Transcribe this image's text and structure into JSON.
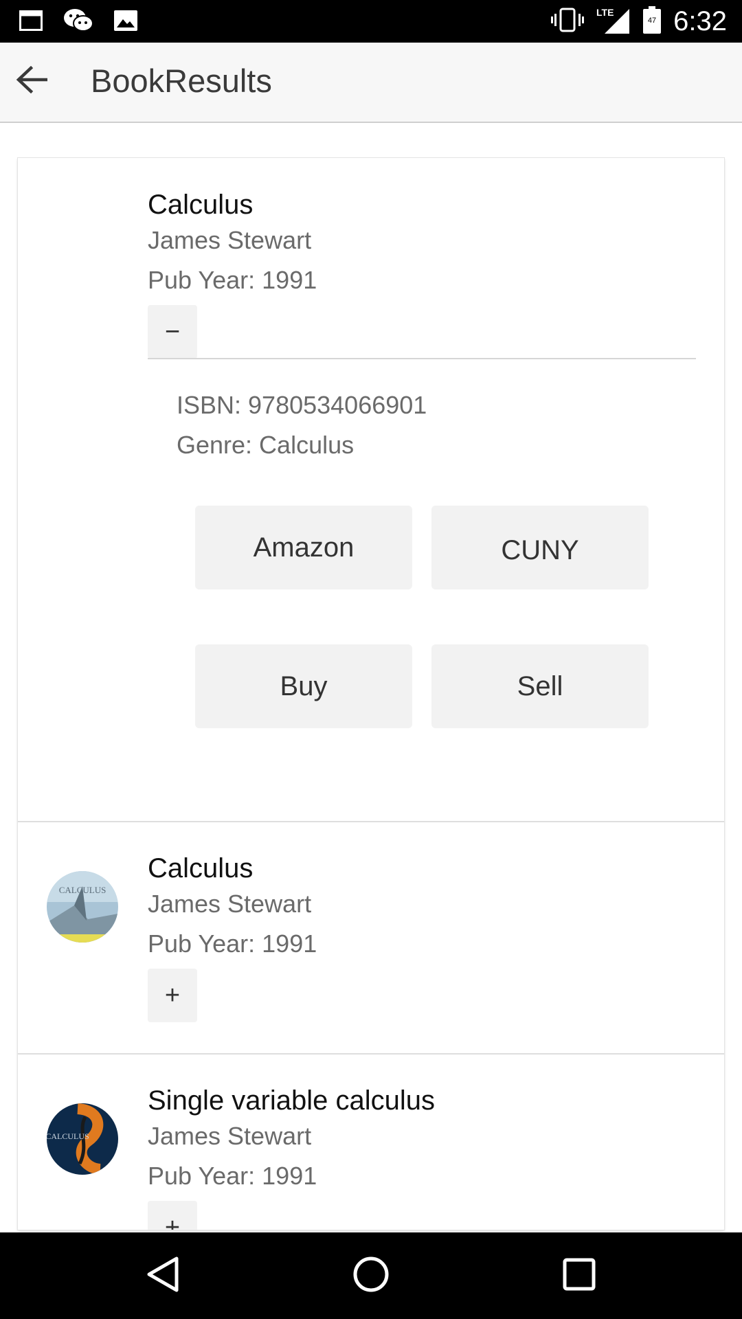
{
  "status_bar": {
    "time": "6:32",
    "network": "LTE",
    "battery": "47",
    "left_icons": [
      "window-icon",
      "wechat-icon",
      "image-icon"
    ],
    "right_icons": [
      "vibrate-icon",
      "signal-icon",
      "battery-icon"
    ]
  },
  "app_bar": {
    "title": "BookResults",
    "back_icon": "arrow-left-icon"
  },
  "results": [
    {
      "title": "Calculus",
      "author": "James Stewart",
      "pub_year": "Pub Year: 1991",
      "expanded": true,
      "toggle_label": "−",
      "isbn": "ISBN: 9780534066901",
      "genre": "Genre: Calculus",
      "actions": {
        "amazon": "Amazon",
        "cuny": "CUNY",
        "buy": "Buy",
        "sell": "Sell"
      }
    },
    {
      "title": "Calculus",
      "author": "James Stewart",
      "pub_year": "Pub Year: 1991",
      "expanded": false,
      "toggle_label": "+",
      "cover_text": "CALCULUS"
    },
    {
      "title": "Single variable calculus",
      "author": "James Stewart",
      "pub_year": "Pub Year: 1991",
      "expanded": false,
      "toggle_label": "+",
      "cover_text": "CALCULUS"
    }
  ],
  "nav_bar": {
    "buttons": [
      "back-triangle-icon",
      "home-circle-icon",
      "recents-square-icon"
    ]
  },
  "colors": {
    "status_bar_bg": "#000000",
    "app_bar_bg": "#f7f7f7",
    "button_bg": "#f2f2f2",
    "secondary_text": "#6a6a6a"
  }
}
